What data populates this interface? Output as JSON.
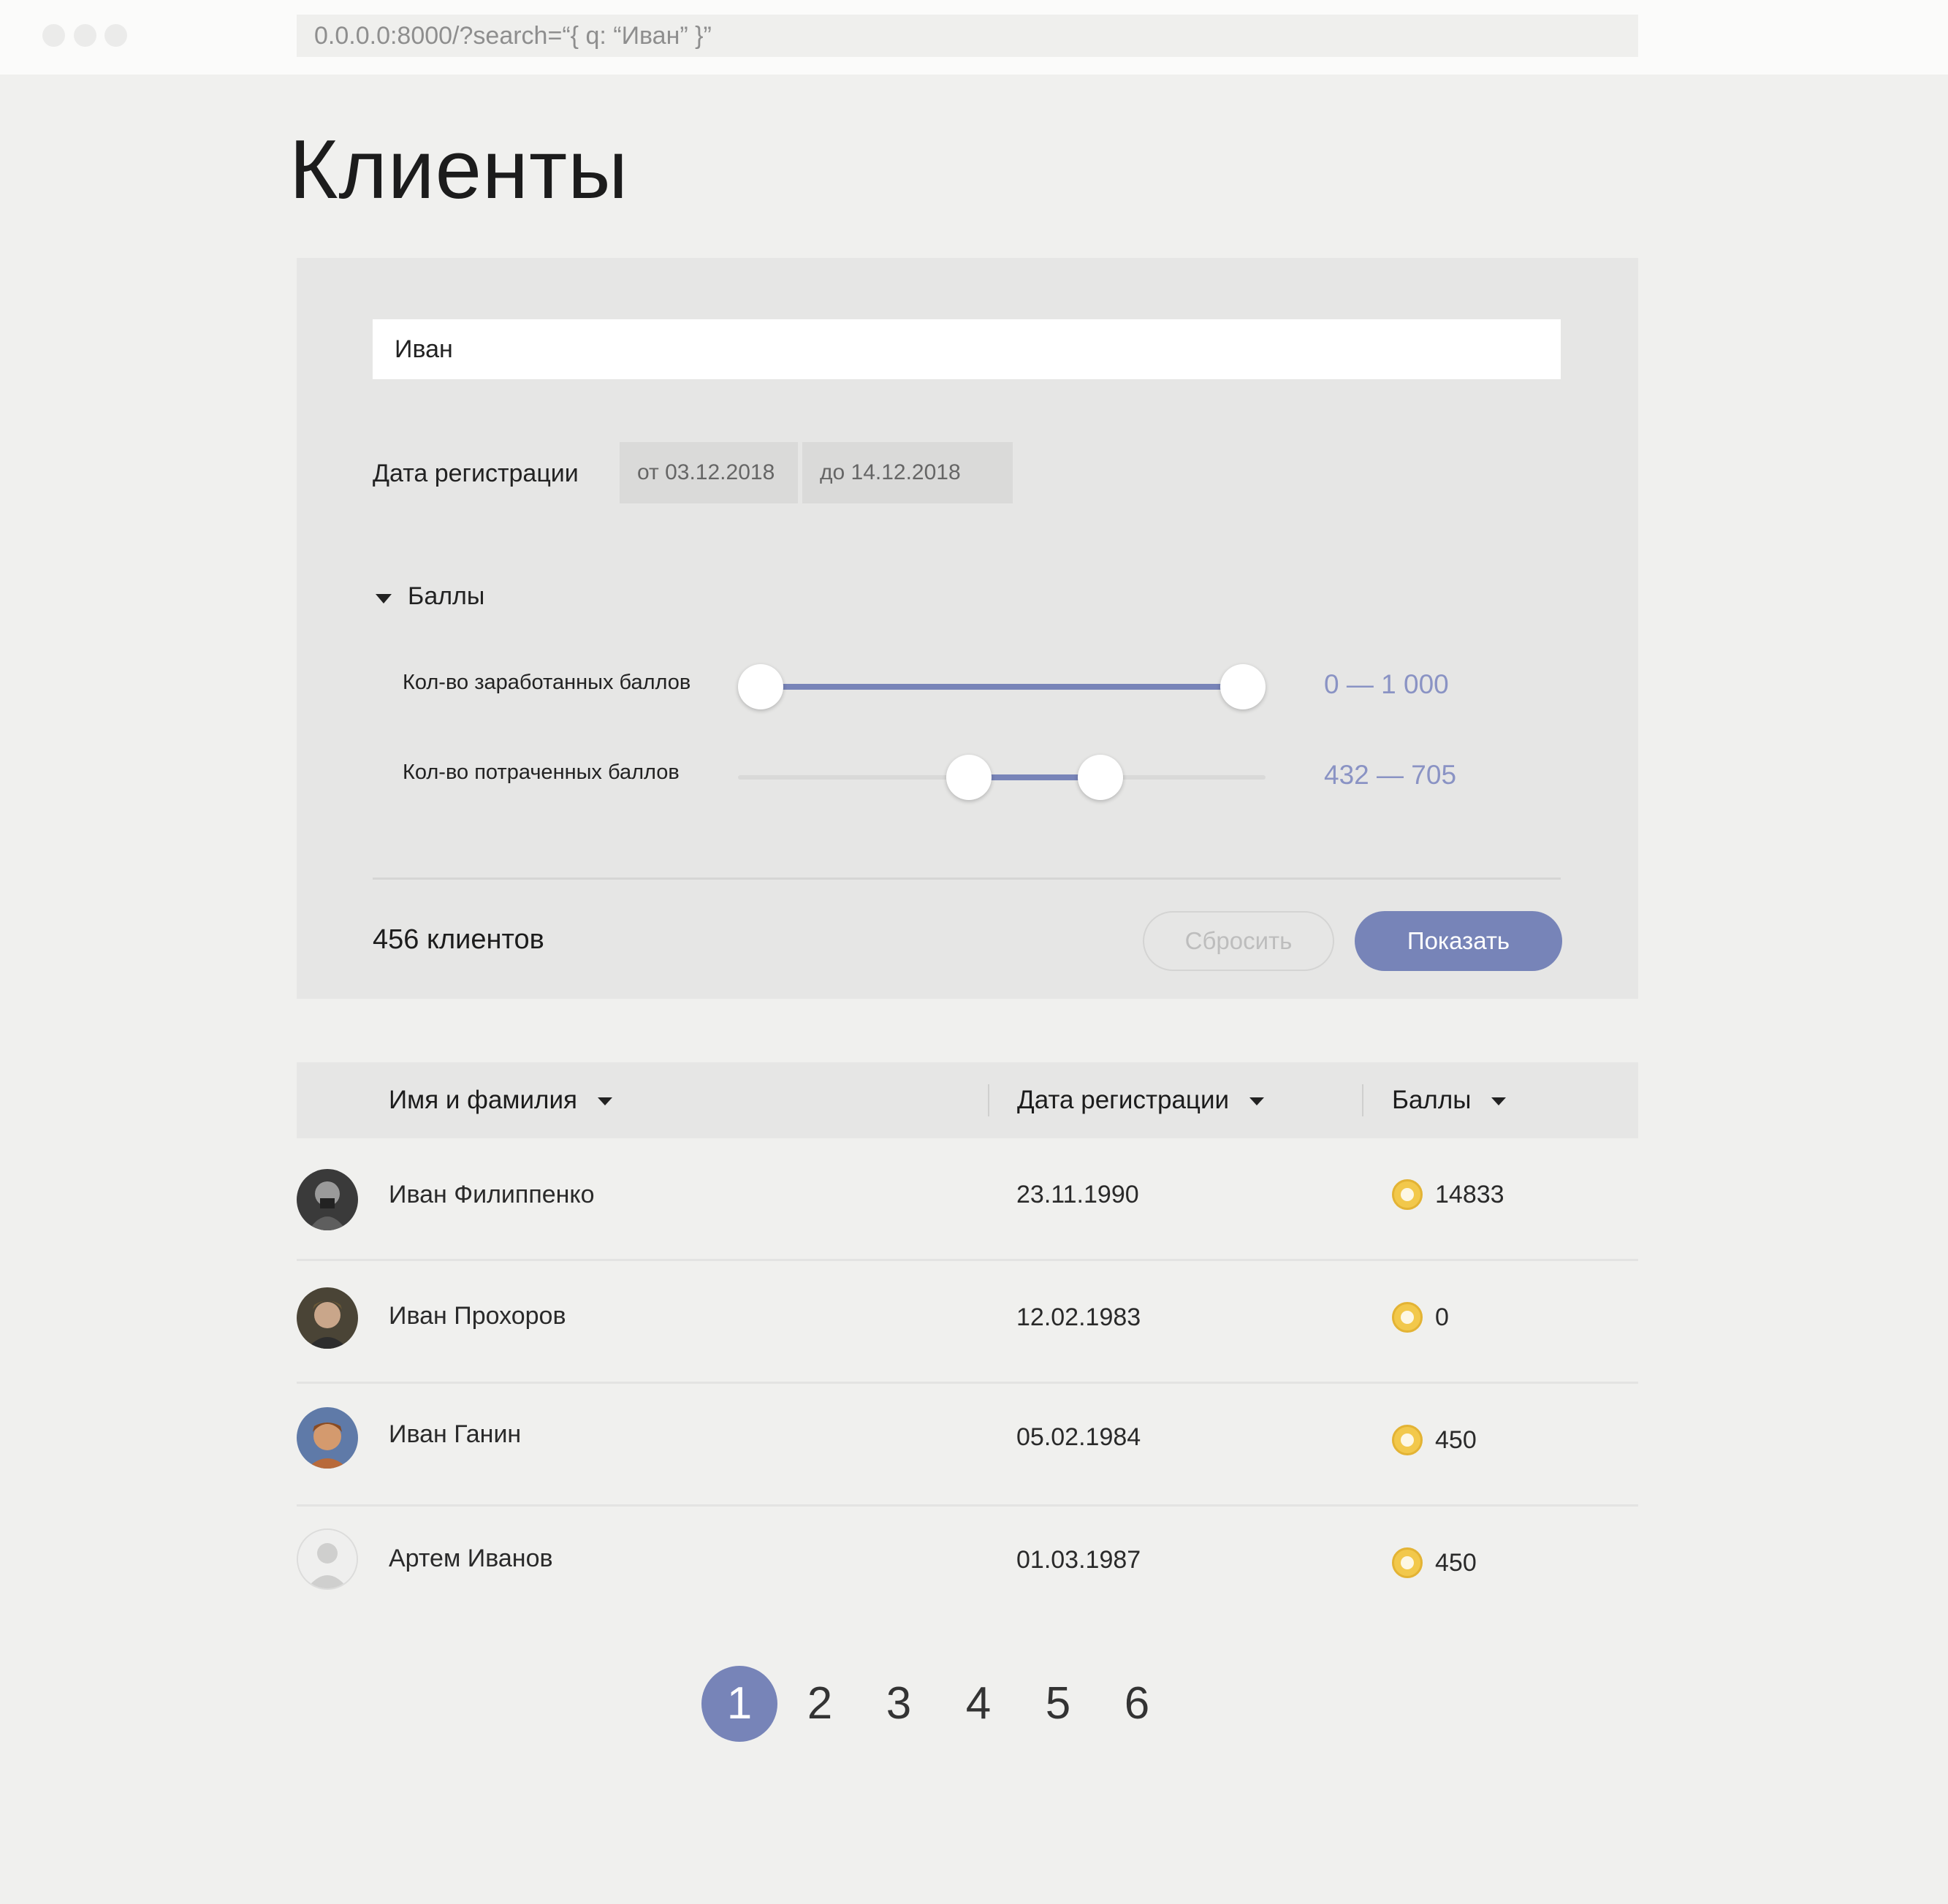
{
  "browser": {
    "url": "0.0.0.0:8000/?search=“{ q: “Иван” }”"
  },
  "page": {
    "title": "Клиенты"
  },
  "filters": {
    "search_value": "Иван",
    "registration_label": "Дата регистрации",
    "date_from": "от 03.12.2018",
    "date_to": "до 14.12.2018",
    "points_section_label": "Баллы",
    "earned": {
      "label": "Кол-во заработанных баллов",
      "range_text": "0 — 1 000",
      "min": 0,
      "max": 1000,
      "scale_max": 1000
    },
    "spent": {
      "label": "Кол-во потраченных баллов",
      "range_text": "432 — 705",
      "min": 432,
      "max": 705,
      "scale_max": 1000
    },
    "result_count": "456 клиентов",
    "reset_label": "Сбросить",
    "show_label": "Показать"
  },
  "table": {
    "columns": [
      {
        "label": "Имя и фамилия"
      },
      {
        "label": "Дата регистрации"
      },
      {
        "label": "Баллы"
      }
    ],
    "rows": [
      {
        "name": "Иван Филиппенко",
        "date": "23.11.1990",
        "points": "14833"
      },
      {
        "name": "Иван Прохоров",
        "date": "12.02.1983",
        "points": "0"
      },
      {
        "name": "Иван Ганин",
        "date": "05.02.1984",
        "points": "450"
      },
      {
        "name": "Артем Иванов",
        "date": "01.03.1987",
        "points": "450"
      }
    ]
  },
  "pagination": {
    "pages": [
      "1",
      "2",
      "3",
      "4",
      "5",
      "6"
    ],
    "current": "1"
  },
  "colors": {
    "accent": "#7784b8",
    "range_text": "#8a93c4",
    "coin": "#f2c84b",
    "background": "#f0f0ee",
    "panel": "#e6e6e5"
  }
}
